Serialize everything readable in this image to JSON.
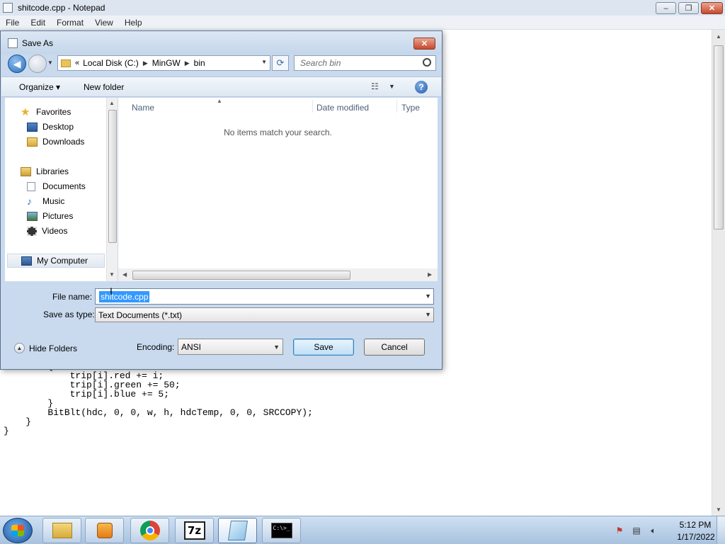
{
  "notepad": {
    "title": "shitcode.cpp - Notepad",
    "menu": [
      "File",
      "Edit",
      "Format",
      "View",
      "Help"
    ],
    "code_lines": [
      "        {",
      "            trip[i].red += i;",
      "            trip[i].green += 50;",
      "            trip[i].blue += 5;",
      "        }",
      "",
      "        BitBlt(hdc, 0, 0, w, h, hdcTemp, 0, 0, SRCCOPY);",
      "    }",
      "}"
    ]
  },
  "dialog": {
    "title": "Save As",
    "address": {
      "prefix": "«",
      "crumbs": [
        "Local Disk (C:)",
        "MinGW",
        "bin"
      ]
    },
    "search_placeholder": "Search bin",
    "toolbar": {
      "organize": "Organize",
      "new_folder": "New folder"
    },
    "nav": {
      "favorites": "Favorites",
      "desktop": "Desktop",
      "downloads": "Downloads",
      "libraries": "Libraries",
      "documents": "Documents",
      "music": "Music",
      "pictures": "Pictures",
      "videos": "Videos",
      "my_computer": "My Computer"
    },
    "columns": {
      "name": "Name",
      "date_modified": "Date modified",
      "type": "Type"
    },
    "empty_message": "No items match your search.",
    "file_name_label": "File name:",
    "file_name_value": "shitcode.cpp",
    "save_as_type_label": "Save as type:",
    "save_as_type_value": "Text Documents (*.txt)",
    "hide_folders": "Hide Folders",
    "encoding_label": "Encoding:",
    "encoding_value": "ANSI",
    "save_button": "Save",
    "cancel_button": "Cancel"
  },
  "taskbar": {
    "clock_time": "5:12 PM",
    "clock_date": "1/17/2022",
    "cmd_text": "C:\\>_"
  },
  "icons": {
    "favorites": "star-icon",
    "desktop": "desktop-icon",
    "downloads": "downloads-folder-icon",
    "libraries": "library-icon",
    "documents": "document-icon",
    "music": "music-note-icon",
    "pictures": "picture-icon",
    "videos": "film-icon",
    "computer": "computer-icon"
  }
}
